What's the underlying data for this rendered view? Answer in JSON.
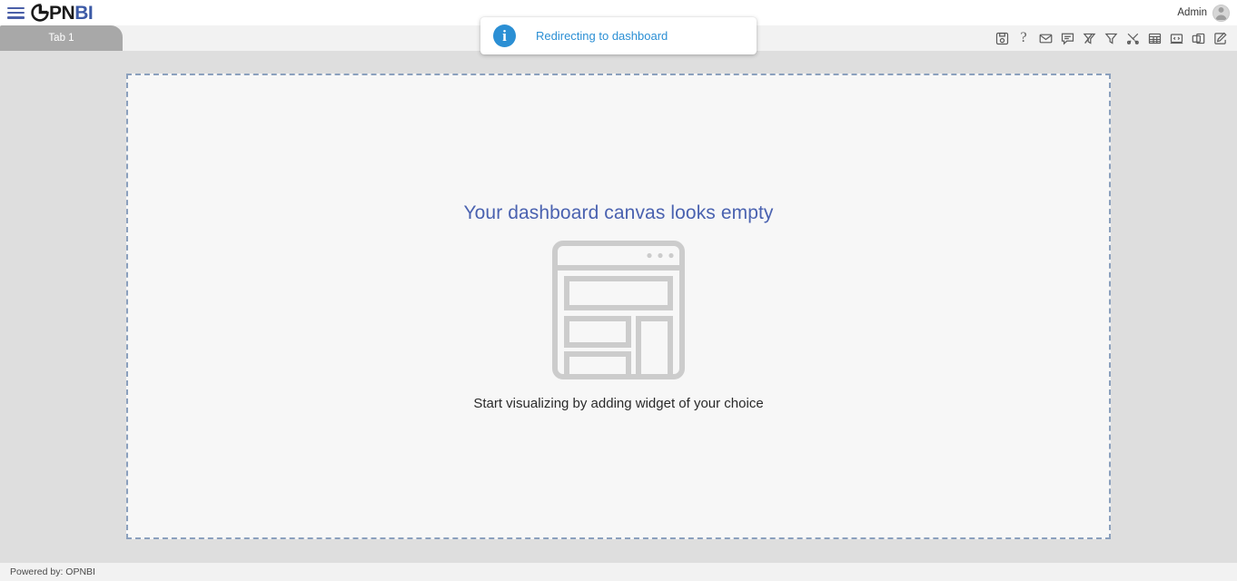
{
  "header": {
    "menu_icon": "hamburger-menu-icon",
    "logo": {
      "mark": "pie-chart-o-icon",
      "text_dark": "PN",
      "text_accent": "BI",
      "accent_color": "#3c5aa6"
    },
    "user_name": "Admin",
    "avatar_icon": "user-avatar-icon"
  },
  "tabs": [
    {
      "label": "Tab 1",
      "active": true
    }
  ],
  "toolbar": {
    "items": [
      {
        "icon": "save-document-icon",
        "label": "Save"
      },
      {
        "icon": "question-mark-icon",
        "label": "Help"
      },
      {
        "icon": "envelope-icon",
        "label": "Mail"
      },
      {
        "icon": "comment-bubble-icon",
        "label": "Comments"
      },
      {
        "icon": "clear-filter-icon",
        "label": "Clear Filter"
      },
      {
        "icon": "filter-funnel-icon",
        "label": "Filter"
      },
      {
        "icon": "tools-icon",
        "label": "Tools"
      },
      {
        "icon": "table-grid-icon",
        "label": "Table"
      },
      {
        "icon": "code-window-icon",
        "label": "Code"
      },
      {
        "icon": "duplicate-icon",
        "label": "Clone"
      },
      {
        "icon": "edit-pencil-icon",
        "label": "Edit"
      }
    ]
  },
  "toast": {
    "icon": "info-circle-icon",
    "message": "Redirecting to dashboard",
    "color": "#2b8fd4"
  },
  "canvas": {
    "empty_state": {
      "title": "Your dashboard canvas looks empty",
      "subtitle": "Start visualizing by adding widget of your choice",
      "illustration": "dashboard-wireframe-icon",
      "title_color": "#4a62b0"
    }
  },
  "footer": {
    "text": "Powered by: OPNBI"
  }
}
